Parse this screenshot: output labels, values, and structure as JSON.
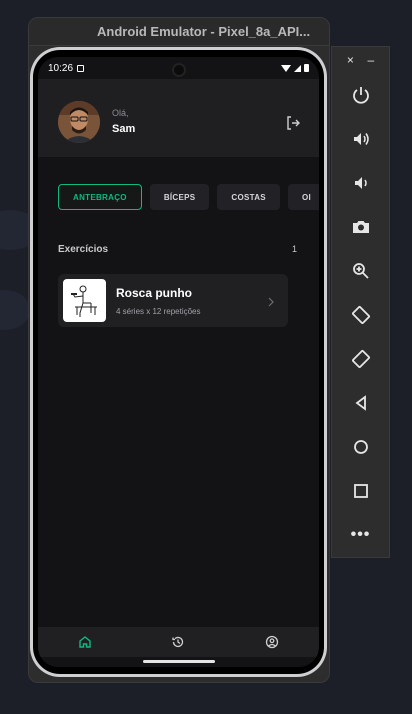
{
  "window": {
    "title": "Android Emulator - Pixel_8a_API..."
  },
  "status_bar": {
    "time": "10:26"
  },
  "header": {
    "greeting": "Olá,",
    "username": "Sam"
  },
  "categories": [
    {
      "label": "ANTEBRAÇO",
      "active": true
    },
    {
      "label": "BÍCEPS",
      "active": false
    },
    {
      "label": "COSTAS",
      "active": false
    },
    {
      "label": "OI",
      "active": false
    }
  ],
  "section": {
    "title": "Exercícios",
    "count": "1"
  },
  "exercise": {
    "name": "Rosca punho",
    "details": "4 séries x 12 repetições"
  },
  "emulator_controls": {
    "close": "×",
    "minimize": "–",
    "more": "•••"
  },
  "accent_color": "#10b981",
  "icons": [
    "logout-icon",
    "home-icon",
    "history-icon",
    "profile-icon",
    "power-icon",
    "volume-up-icon",
    "volume-down-icon",
    "camera-icon",
    "zoom-icon",
    "rotate-left-icon",
    "rotate-right-icon",
    "back-icon",
    "home-circle-icon",
    "overview-icon",
    "more-icon"
  ]
}
